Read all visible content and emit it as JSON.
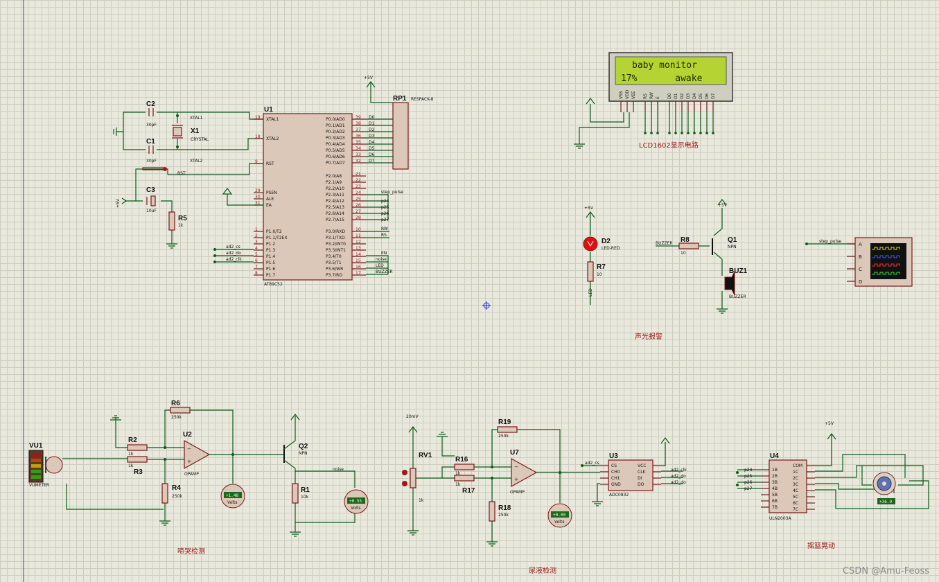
{
  "components": {
    "C2": {
      "ref": "C2",
      "value": "30pF"
    },
    "C1": {
      "ref": "C1",
      "value": "30pF"
    },
    "C3": {
      "ref": "C3",
      "value": "10uF"
    },
    "X1": {
      "ref": "X1",
      "value": "CRYSTAL"
    },
    "R5": {
      "ref": "R5",
      "value": "1k"
    },
    "U1": {
      "ref": "U1",
      "value": "AT89C52"
    },
    "RP1": {
      "ref": "RP1",
      "value": "RESPACK-8"
    },
    "D2": {
      "ref": "D2",
      "value": "LED-RED"
    },
    "R7": {
      "ref": "R7",
      "value": "10"
    },
    "R8": {
      "ref": "R8",
      "value": "10"
    },
    "Q1": {
      "ref": "Q1",
      "value": "NPN"
    },
    "BUZ1": {
      "ref": "BUZ1",
      "value": "BUZZER"
    },
    "VU1": {
      "ref": "VU1",
      "value": "VUMETER"
    },
    "R2": {
      "ref": "R2",
      "value": "1k"
    },
    "R3": {
      "ref": "R3",
      "value": "1k"
    },
    "R4": {
      "ref": "R4",
      "value": "250k"
    },
    "R6": {
      "ref": "R6",
      "value": "250k"
    },
    "U2": {
      "ref": "U2",
      "value": "OPAMP"
    },
    "Q2": {
      "ref": "Q2",
      "value": "NPN"
    },
    "R1": {
      "ref": "R1",
      "value": "10k"
    },
    "RV1": {
      "ref": "RV1",
      "value": "1k"
    },
    "R16": {
      "ref": "R16",
      "value": "1k"
    },
    "R17": {
      "ref": "R17",
      "value": "1k"
    },
    "R18": {
      "ref": "R18",
      "value": "250k"
    },
    "R19": {
      "ref": "R19",
      "value": "250k"
    },
    "U7": {
      "ref": "U7",
      "value": "OPAMP"
    },
    "U3": {
      "ref": "U3",
      "value": "ADC0832"
    },
    "U4": {
      "ref": "U4",
      "value": "ULN2003A"
    }
  },
  "lcd": {
    "line1": "baby monitor",
    "line2": "17%       awake",
    "pins": [
      "VSS",
      "VDD",
      "VEE",
      "RS",
      "RW",
      "E",
      "D0",
      "D1",
      "D2",
      "D3",
      "D4",
      "D5",
      "D6",
      "D7"
    ]
  },
  "net_labels": {
    "xtal1": "XTAL1",
    "xtal2": "XTAL2",
    "rst": "RST",
    "d": [
      "D0",
      "D1",
      "D2",
      "D3",
      "D4",
      "D5",
      "D6",
      "D7"
    ],
    "step_pulse": "step_pulse",
    "p24": "p24",
    "p25": "p25",
    "p26": "p26",
    "p27": "p27",
    "rw": "RW",
    "rs": "RS",
    "ad2_cs": "ad2_cs",
    "ad2_do": "ad2_do",
    "ad2_clk": "ad2_clk",
    "en": "EN",
    "noise": "noise",
    "led": "LED",
    "buzzer": "BUZZER",
    "ledr": "LED",
    "cs": "cs",
    "plus5v": "+5V",
    "mv20": "20mV"
  },
  "u1_pins_left": [
    "XTAL1",
    "XTAL2",
    "RST",
    "PSEN",
    "ALE",
    "EA",
    "P1.0/T2",
    "P1.1/T2EX",
    "P1.2",
    "P1.3",
    "P1.4",
    "P1.5",
    "P1.6",
    "P1.7"
  ],
  "u1_pins_right": [
    "P0.0/AD0",
    "P0.1/AD1",
    "P0.2/AD2",
    "P0.3/AD3",
    "P0.4/AD4",
    "P0.5/AD5",
    "P0.6/AD6",
    "P0.7/AD7",
    "P2.0/A8",
    "P2.1/A9",
    "P2.2/A10",
    "P2.3/A11",
    "P2.4/A12",
    "P2.5/A13",
    "P2.6/A14",
    "P2.7/A15",
    "P3.0/RXD",
    "P3.1/TXD",
    "P3.2/INT0",
    "P3.3/INT1",
    "P3.4/T0",
    "P3.5/T1",
    "P3.6/WR",
    "P3.7/RD"
  ],
  "u3_pins_left": [
    "CS",
    "CH0",
    "CH1",
    "GND"
  ],
  "u3_pins_right": [
    "VCC",
    "CLK",
    "DI",
    "DO"
  ],
  "u4_pins_left": [
    "1B",
    "2B",
    "3B",
    "4B",
    "5B",
    "6B",
    "7B"
  ],
  "u4_pins_right": [
    "COM",
    "1C",
    "2C",
    "3C",
    "4C",
    "5C",
    "6C",
    "7C"
  ],
  "scope_channels": [
    "A",
    "B",
    "C",
    "D"
  ],
  "voltmeters": {
    "vm1": "+1.48",
    "vm2": "+0.55",
    "vm3": "+0.00",
    "unit": "Volts"
  },
  "motor_readout": "+36.9",
  "sections": {
    "lcd": "LCD1602显示电路",
    "alarm": "声光报警",
    "cry": "啼哭检测",
    "urine": "尿液检测",
    "cradle": "摇篮晃动"
  },
  "watermark": "CSDN @Amu-Feoss",
  "colors": {
    "wire": "#0a5c18",
    "component": "#7a1818",
    "lcd_bg": "#b5d433",
    "section_text": "#a01818"
  }
}
